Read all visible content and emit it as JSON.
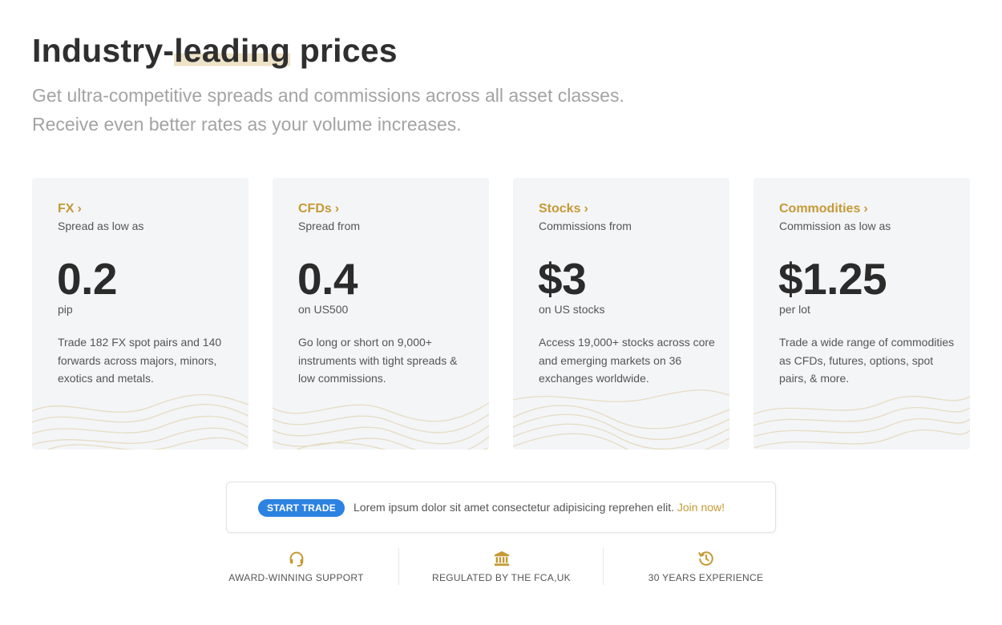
{
  "header": {
    "title_before": "Industry-",
    "title_highlight": "leading",
    "title_after": " prices",
    "subtitle_line1": "Get ultra-competitive spreads and commissions across all asset classes.",
    "subtitle_line2": "Receive even better rates as your volume increases."
  },
  "cards": [
    {
      "title": "FX",
      "label": "Spread as low as",
      "value": "0.2",
      "unit": "pip",
      "description": "Trade 182 FX spot pairs and 140 forwards across majors, minors, exotics and metals."
    },
    {
      "title": "CFDs",
      "label": "Spread from",
      "value": "0.4",
      "unit": "on US500",
      "description": "Go long or short on 9,000+ instruments with tight spreads & low commissions."
    },
    {
      "title": "Stocks",
      "label": "Commissions from",
      "value": "$3",
      "unit": "on US stocks",
      "description": "Access 19,000+ stocks across core and emerging markets on 36 exchanges worldwide."
    },
    {
      "title": "Commodities",
      "label": "Commission as low as",
      "value": "$1.25",
      "unit": "per lot",
      "description": "Trade a wide range of commodities as CFDs, futures, options, spot pairs, & more."
    }
  ],
  "card_chevron": "›",
  "banner": {
    "badge": "START TRADE",
    "text": "Lorem ipsum dolor sit amet consectetur adipisicing reprehen elit.",
    "link": "Join now!"
  },
  "features": [
    {
      "icon": "headset-icon",
      "label": "AWARD-WINNING SUPPORT"
    },
    {
      "icon": "bank-icon",
      "label": "REGULATED BY THE FCA,UK"
    },
    {
      "icon": "history-icon",
      "label": "30 YEARS EXPERIENCE"
    }
  ],
  "colors": {
    "accent": "#c49a35",
    "badge": "#2c82e0",
    "card_bg": "#f4f5f7",
    "highlight": "#eee3c8",
    "subtitle": "#a3a3a3"
  }
}
